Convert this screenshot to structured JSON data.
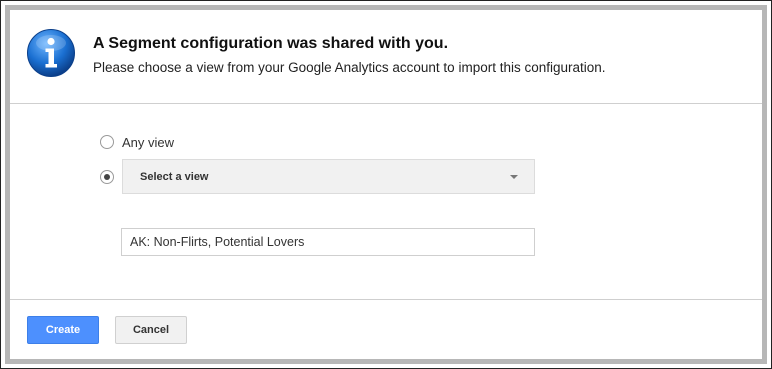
{
  "dialog": {
    "title": "A Segment configuration was shared with you.",
    "subtitle": "Please choose a view from your Google Analytics account to import this configuration.",
    "info_icon": "info-icon"
  },
  "options": {
    "any_view_label": "Any view",
    "selected": "select-view",
    "select_placeholder": "Select a view"
  },
  "segment_name": {
    "value": "AK: Non-Flirts, Potential Lovers"
  },
  "footer": {
    "create_label": "Create",
    "cancel_label": "Cancel"
  },
  "colors": {
    "accent": "#4d90fe",
    "info_icon": "#1a6fd1",
    "border": "#b7b7b7"
  }
}
